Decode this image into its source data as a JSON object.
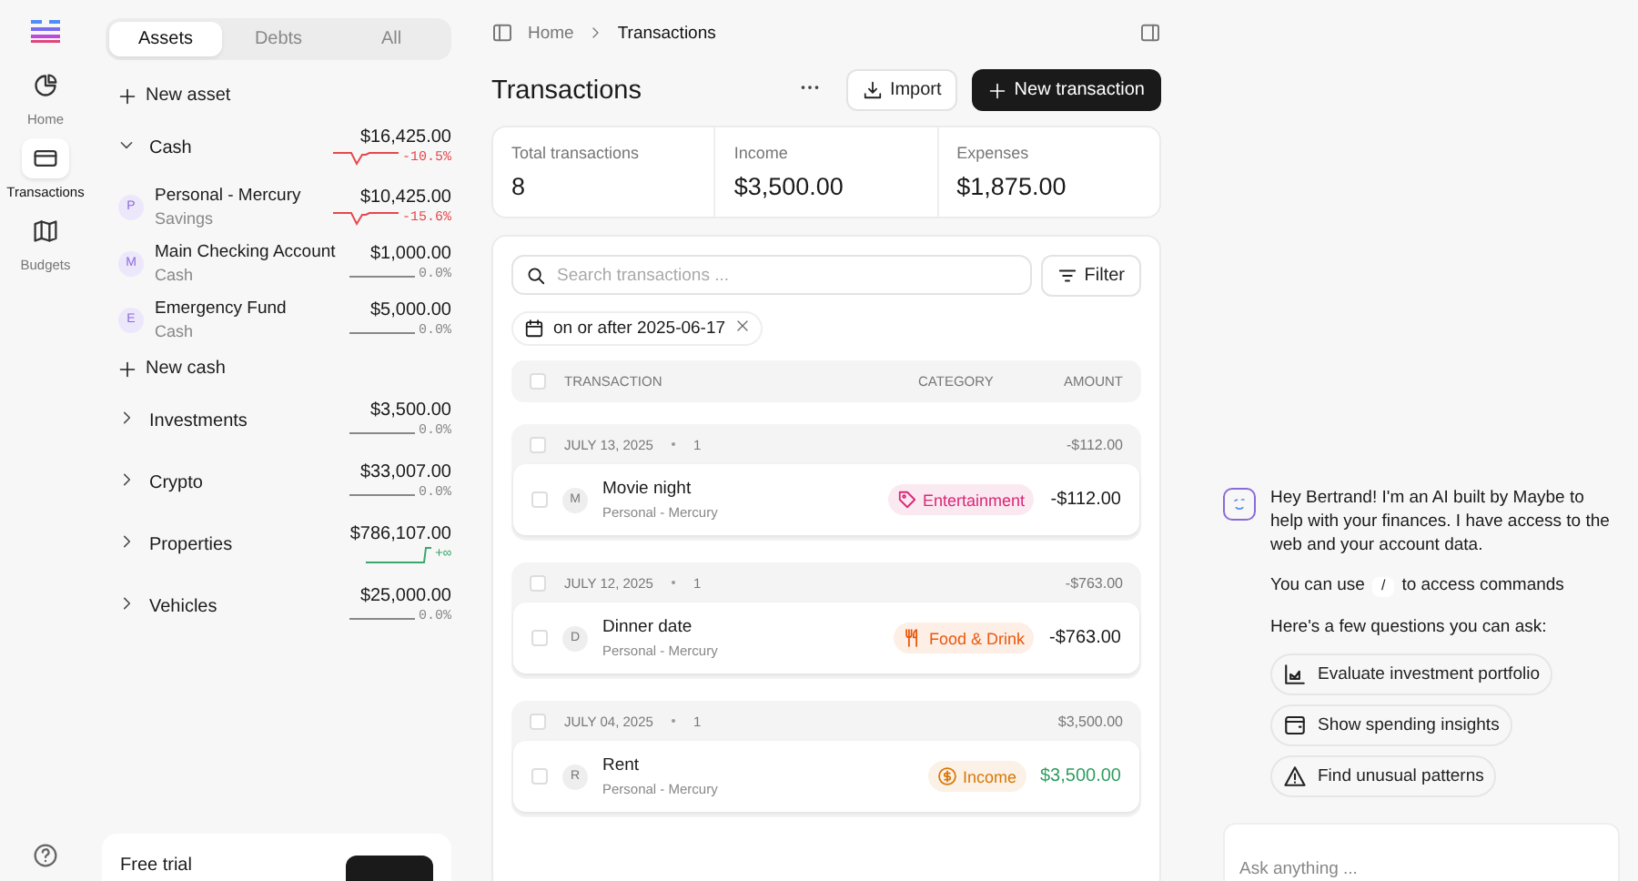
{
  "nav": [
    {
      "label": "Home",
      "kind": "home",
      "selected": false
    },
    {
      "label": "Transactions",
      "kind": "transactions",
      "selected": true
    },
    {
      "label": "Budgets",
      "kind": "budgets",
      "selected": false
    }
  ],
  "sidebar": {
    "tabs": [
      {
        "label": "Assets",
        "selected": true
      },
      {
        "label": "Debts",
        "selected": false
      },
      {
        "label": "All",
        "selected": false
      }
    ],
    "new_asset": "New asset",
    "groups": [
      {
        "name": "Cash",
        "expanded": true,
        "amount": "$16,425.00",
        "change": "-10.5%",
        "kind": "down",
        "accounts": [
          {
            "initial": "P",
            "name": "Personal - Mercury",
            "type": "Savings",
            "amount": "$10,425.00",
            "change": "-15.6%",
            "kind": "down"
          },
          {
            "initial": "M",
            "name": "Main Checking Account",
            "type": "Cash",
            "amount": "$1,000.00",
            "change": "0.0%",
            "kind": "flat"
          },
          {
            "initial": "E",
            "name": "Emergency Fund",
            "type": "Cash",
            "amount": "$5,000.00",
            "change": "0.0%",
            "kind": "flat"
          }
        ],
        "new_label": "New cash"
      },
      {
        "name": "Investments",
        "expanded": false,
        "amount": "$3,500.00",
        "change": "0.0%",
        "kind": "flat"
      },
      {
        "name": "Crypto",
        "expanded": false,
        "amount": "$33,007.00",
        "change": "0.0%",
        "kind": "flat"
      },
      {
        "name": "Properties",
        "expanded": false,
        "amount": "$786,107.00",
        "change": "+∞",
        "kind": "up"
      },
      {
        "name": "Vehicles",
        "expanded": false,
        "amount": "$25,000.00",
        "change": "0.0%",
        "kind": "flat"
      }
    ],
    "trial": {
      "title": "Free trial"
    }
  },
  "breadcrumb": [
    "Home",
    "Transactions"
  ],
  "title": "Transactions",
  "actions": {
    "import": "Import",
    "new": "New transaction"
  },
  "stats": [
    {
      "label": "Total transactions",
      "value": "8"
    },
    {
      "label": "Income",
      "value": "$3,500.00"
    },
    {
      "label": "Expenses",
      "value": "$1,875.00"
    }
  ],
  "search": {
    "placeholder": "Search transactions ..."
  },
  "filter_button": "Filter",
  "filter_chip": "on or after 2025-06-17",
  "table": {
    "columns": [
      "TRANSACTION",
      "CATEGORY",
      "AMOUNT"
    ],
    "checked": false,
    "groups": [
      {
        "date": "JULY 13, 2025",
        "count": "1",
        "total": "-$112.00",
        "checked": false,
        "rows": [
          {
            "initial": "M",
            "name": "Movie night",
            "account": "Personal - Mercury",
            "category": "Entertainment",
            "kind": "entertainment",
            "color": "#db2777",
            "amount": "-$112.00",
            "checked": false
          }
        ]
      },
      {
        "date": "JULY 12, 2025",
        "count": "1",
        "total": "-$763.00",
        "checked": false,
        "rows": [
          {
            "initial": "D",
            "name": "Dinner date",
            "account": "Personal - Mercury",
            "category": "Food & Drink",
            "kind": "food",
            "color": "#ea580c",
            "amount": "-$763.00",
            "checked": false
          }
        ]
      },
      {
        "date": "JULY 04, 2025",
        "count": "1",
        "total": "$3,500.00",
        "checked": false,
        "rows": [
          {
            "initial": "R",
            "name": "Rent",
            "account": "Personal - Mercury",
            "category": "Income",
            "kind": "income",
            "color": "#d97706",
            "amount": "$3,500.00",
            "checked": false
          }
        ]
      }
    ]
  },
  "chat": {
    "intro": "Hey Bertrand! I'm an AI built by Maybe to help with your finances. I have access to the web and your account data.",
    "commands_before": "You can use",
    "command_key": "/",
    "commands_after": "to access commands",
    "questions_label": "Here's a few questions you can ask:",
    "suggestions": [
      {
        "kind": "portfolio",
        "label": "Evaluate investment portfolio"
      },
      {
        "kind": "spending",
        "label": "Show spending insights"
      },
      {
        "kind": "patterns",
        "label": "Find unusual patterns"
      }
    ],
    "input": {
      "placeholder": "Ask anything ..."
    }
  }
}
